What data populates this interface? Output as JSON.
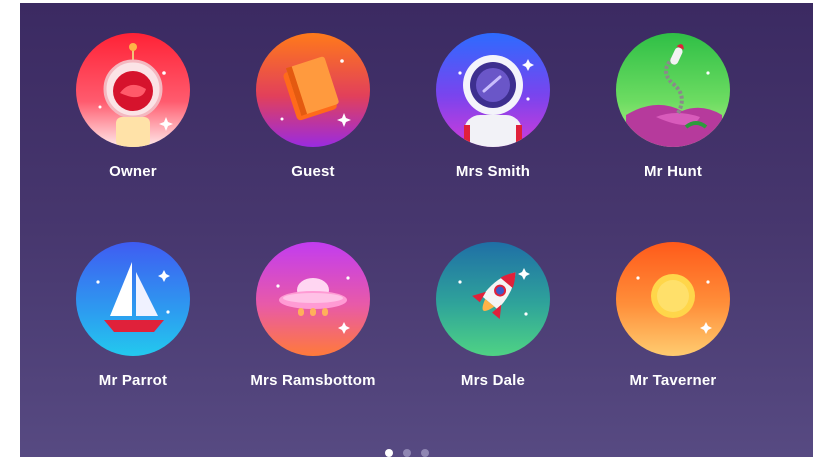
{
  "profiles": [
    {
      "name": "Owner",
      "icon": "astronaut-fishbowl-icon",
      "gradient": [
        "#ff2a3c",
        "#fde7e7"
      ]
    },
    {
      "name": "Guest",
      "icon": "book-icon",
      "gradient": [
        "#ff7a1a",
        "#9a2be0"
      ]
    },
    {
      "name": "Mrs Smith",
      "icon": "astronaut-helmet-icon",
      "gradient": [
        "#2d6bff",
        "#d13bd8"
      ]
    },
    {
      "name": "Mr Hunt",
      "icon": "rocket-island-icon",
      "gradient": [
        "#36c24a",
        "#b9f089"
      ]
    },
    {
      "name": "Mr Parrot",
      "icon": "sailboat-icon",
      "gradient": [
        "#3f66f5",
        "#23c9ee"
      ]
    },
    {
      "name": "Mrs Ramsbottom",
      "icon": "ufo-icon",
      "gradient": [
        "#c23cf0",
        "#ff7a3a"
      ]
    },
    {
      "name": "Mrs Dale",
      "icon": "rocket-icon",
      "gradient": [
        "#1f6fa6",
        "#4fd384"
      ]
    },
    {
      "name": "Mr Taverner",
      "icon": "sun-icon",
      "gradient": [
        "#ff6a1a",
        "#ffcc70"
      ]
    }
  ],
  "pager": {
    "pages": 3,
    "current": 1
  }
}
